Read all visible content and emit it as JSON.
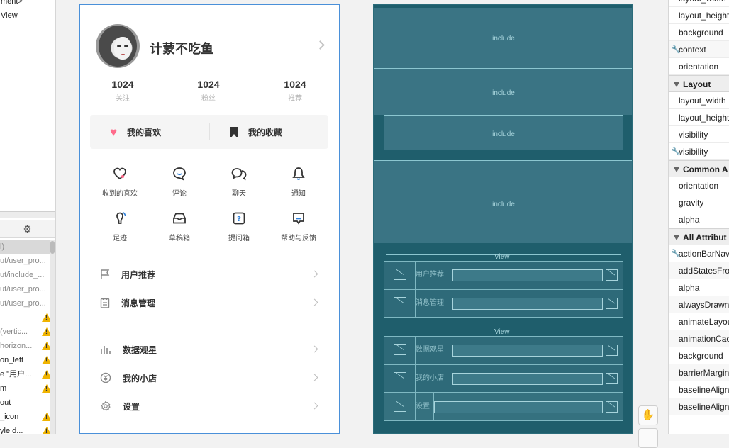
{
  "component_tree": {
    "items": [
      "ment>",
      "View"
    ]
  },
  "component_list": {
    "rows": [
      {
        "text": "l)",
        "warn": false,
        "selected": true,
        "dim": true
      },
      {
        "text": "ut/user_pro...",
        "warn": false,
        "dim": true
      },
      {
        "text": "ut/include_...",
        "warn": false,
        "dim": true
      },
      {
        "text": "ut/user_pro...",
        "warn": false,
        "dim": true
      },
      {
        "text": "ut/user_pro...",
        "warn": false,
        "dim": true
      },
      {
        "text": "",
        "warn": true
      },
      {
        "text": "  (vertic...",
        "warn": true,
        "dim": true
      },
      {
        "text": "horizon...",
        "warn": true,
        "dim": true
      },
      {
        "text": "on_left",
        "warn": true
      },
      {
        "text": "e  \"用户...",
        "warn": true
      },
      {
        "text": "m",
        "warn": true
      },
      {
        "text": "out",
        "warn": false
      },
      {
        "text": "_icon",
        "warn": true
      },
      {
        "text": "yle d...",
        "warn": true
      }
    ]
  },
  "profile": {
    "name": "计蒙不吃鱼",
    "stats": [
      {
        "value": "1024",
        "label": "关注"
      },
      {
        "value": "1024",
        "label": "粉丝"
      },
      {
        "value": "1024",
        "label": "推荐"
      }
    ],
    "likes_label": "我的喜欢",
    "collections_label": "我的收藏",
    "grid": [
      {
        "label": "收到的喜欢",
        "icon": "heart-outline-icon"
      },
      {
        "label": "评论",
        "icon": "comment-icon"
      },
      {
        "label": "聊天",
        "icon": "chat-icon"
      },
      {
        "label": "通知",
        "icon": "bell-icon"
      },
      {
        "label": "足迹",
        "icon": "footprint-icon"
      },
      {
        "label": "草稿箱",
        "icon": "drafts-icon"
      },
      {
        "label": "提问箱",
        "icon": "question-box-icon"
      },
      {
        "label": "帮助与反馈",
        "icon": "help-feedback-icon"
      }
    ],
    "menu": [
      {
        "label": "用户推荐",
        "icon": "flag-icon"
      },
      {
        "label": "消息管理",
        "icon": "clipboard-icon"
      },
      {
        "label": "数据观星",
        "icon": "bar-chart-icon"
      },
      {
        "label": "我的小店",
        "icon": "yen-coin-icon"
      },
      {
        "label": "设置",
        "icon": "gear-icon"
      }
    ],
    "accent_color": "#ff6b8b"
  },
  "blueprint": {
    "include_labels": [
      "include",
      "include",
      "include",
      "include"
    ],
    "view_labels": [
      "View",
      "View"
    ],
    "rows": [
      "用户推荐",
      "消息管理",
      "数据观星",
      "我的小店",
      "设置"
    ]
  },
  "attributes": {
    "top": [
      {
        "label": "layout_width",
        "wrench": false
      },
      {
        "label": "layout_height",
        "wrench": false
      },
      {
        "label": "background",
        "wrench": false
      },
      {
        "label": "context",
        "wrench": true
      },
      {
        "label": "orientation",
        "wrench": false
      }
    ],
    "layout_section": "Layout",
    "layout": [
      {
        "label": "layout_width",
        "wrench": false
      },
      {
        "label": "layout_height",
        "wrench": false
      },
      {
        "label": "visibility",
        "wrench": false
      },
      {
        "label": "visibility",
        "wrench": true
      }
    ],
    "common_section": "Common A",
    "common": [
      {
        "label": "orientation",
        "wrench": false
      },
      {
        "label": "gravity",
        "wrench": false
      },
      {
        "label": "alpha",
        "wrench": false
      }
    ],
    "all_section": "All Attribut",
    "all": [
      {
        "label": "actionBarNav",
        "wrench": true
      },
      {
        "label": "addStatesFrom",
        "wrench": false
      },
      {
        "label": "alpha",
        "wrench": false
      },
      {
        "label": "alwaysDrawnW",
        "wrench": false
      },
      {
        "label": "animateLayou",
        "wrench": false
      },
      {
        "label": "animationCac",
        "wrench": false
      },
      {
        "label": "background",
        "wrench": false
      },
      {
        "label": "barrierMargin",
        "wrench": false
      },
      {
        "label": "baselineAligne",
        "wrench": false
      },
      {
        "label": "baselineAlign",
        "wrench": false
      }
    ]
  }
}
